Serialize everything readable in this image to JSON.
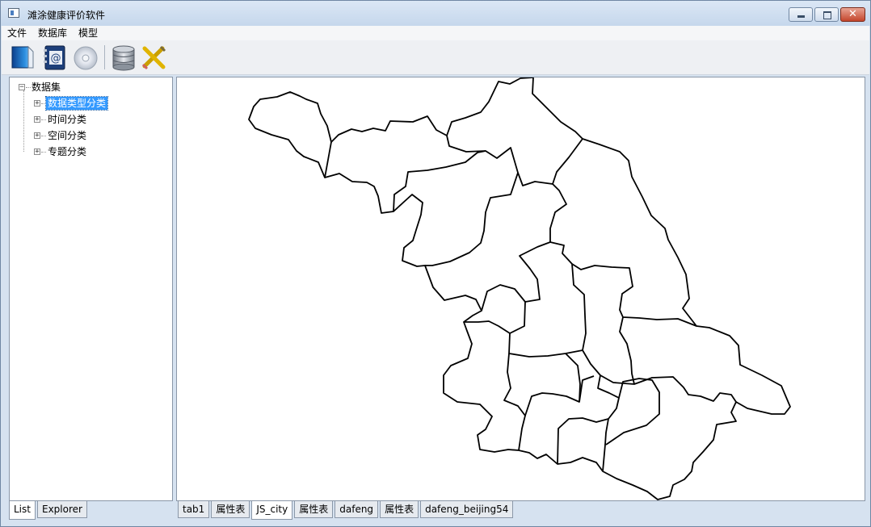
{
  "window": {
    "title": "滩涂健康评价软件",
    "close_glyph": "✕"
  },
  "menu": [
    "文件",
    "数据库",
    "模型"
  ],
  "toolbar": [
    "open-file-icon",
    "address-book-icon",
    "cd-disc-icon",
    "database-icon",
    "tools-icon"
  ],
  "tree": {
    "root": "数据集",
    "root_toggle": "−",
    "child_toggle": "+",
    "children": [
      "数据类型分类",
      "时间分类",
      "空间分类",
      "专题分类"
    ],
    "selected": "数据类型分类"
  },
  "left_tabs": [
    "List",
    "Explorer"
  ],
  "left_active_tab": "List",
  "map_tabs": [
    "tab1",
    "属性表",
    "JS_city",
    "属性表",
    "dafeng",
    "属性表",
    "dafeng_beijing54"
  ],
  "map_active_tab": "JS_city",
  "map": {
    "layer": "JS_city",
    "line_color": "#000000",
    "background": "#ffffff"
  }
}
